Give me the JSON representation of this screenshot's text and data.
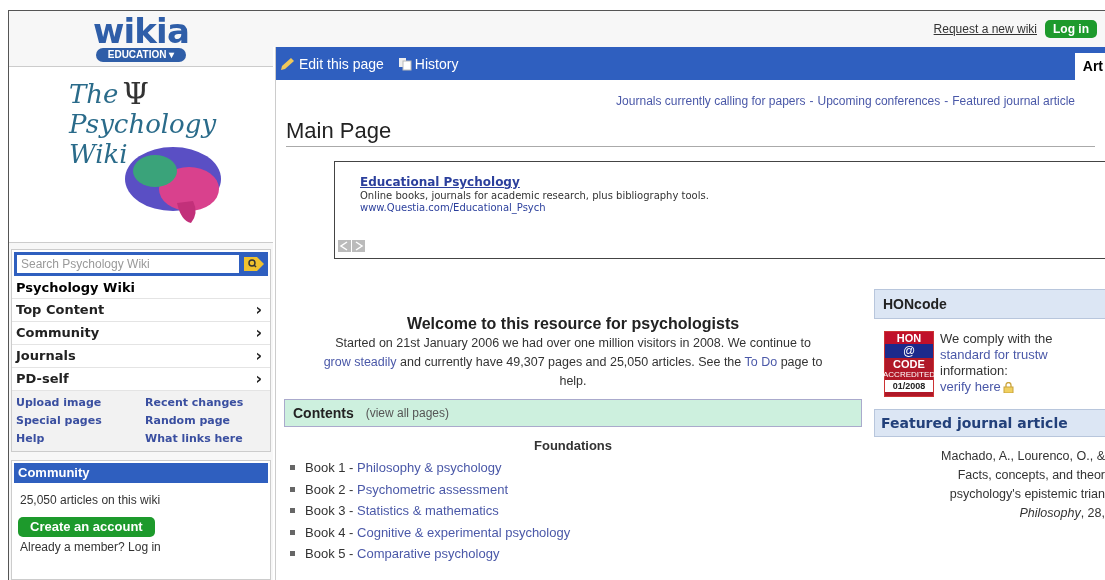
{
  "wikia_logo": {
    "wordmark": "wikia",
    "hub_button": "EDUCATION ▾"
  },
  "wiki_logo": {
    "line_1": "The",
    "symbol": "Ψ",
    "line_2": "Psychology",
    "line_3": "Wiki"
  },
  "search": {
    "placeholder": "Search Psychology Wiki"
  },
  "sidebar": {
    "title": "Psychology Wiki",
    "items": [
      {
        "label": "Top Content",
        "arrow": "›"
      },
      {
        "label": "Community",
        "arrow": "›"
      },
      {
        "label": "Journals",
        "arrow": "›"
      },
      {
        "label": "PD-self",
        "arrow": "›"
      }
    ],
    "links": [
      "Upload image",
      "Recent changes",
      "Special pages",
      "Random page",
      "Help",
      "What links here"
    ]
  },
  "community": {
    "title": "Community",
    "stat": "25,050 articles on this wiki",
    "button": "Create an account",
    "login_line": "Already a member? Log in"
  },
  "header": {
    "request_link": "Request a new wiki",
    "login_button": "Log in"
  },
  "toolbar": {
    "buttons": [
      {
        "kind": "edit",
        "label": "Edit this page"
      },
      {
        "kind": "history",
        "label": "History"
      }
    ],
    "tab": "Art"
  },
  "top_links": {
    "links": [
      "Journals currently calling for papers",
      "Upcoming conferences",
      "Featured journal article"
    ],
    "separator": "-"
  },
  "page_title": "Main Page",
  "ad": {
    "title": "Educational Psychology",
    "description": "Online books, journals for academic research, plus bibliography tools.",
    "url": "www.Questia.com/Educational_Psych"
  },
  "welcome": {
    "title": "Welcome to this resource for psychologists",
    "segments": [
      {
        "text": "Started on 21st January 2006 we had over one million visitors in 2008. We continue to ",
        "link": false
      },
      {
        "text": "grow steadily",
        "link": true
      },
      {
        "text": " and currently have 49,307 pages and 25,050 articles. See the ",
        "link": false
      },
      {
        "text": "To Do",
        "link": true
      },
      {
        "text": " page to help.",
        "link": false
      }
    ]
  },
  "contents": {
    "title": "Contents",
    "link": "(view all pages)",
    "section": "Foundations",
    "books": [
      {
        "number": "Book 1 - ",
        "title": "Philosophy & psychology"
      },
      {
        "number": "Book 2 - ",
        "title": "Psychometric assessment"
      },
      {
        "number": "Book 3 - ",
        "title": "Statistics & mathematics"
      },
      {
        "number": "Book 4 - ",
        "title": "Cognitive & experimental psychology"
      },
      {
        "number": "Book 5 - ",
        "title": "Comparative psychology"
      }
    ]
  },
  "honcode": {
    "title": "HONcode",
    "badge": {
      "top": "HON",
      "middle": "@",
      "bottom": "CODE",
      "accredited": "ACCREDITED",
      "date": "01/2008"
    },
    "lines": [
      {
        "text": "We comply with the",
        "link": false
      },
      {
        "text": "standard for trustw",
        "link": true
      },
      {
        "text": "information:",
        "link": false
      }
    ],
    "verify": "verify here"
  },
  "featured": {
    "title": "Featured journal article",
    "lines": [
      "Machado, A., Lourenco, O., &",
      "Facts, concepts, and theor",
      "psychology's epistemic trian",
      "*Philosophy*, 28,"
    ]
  }
}
